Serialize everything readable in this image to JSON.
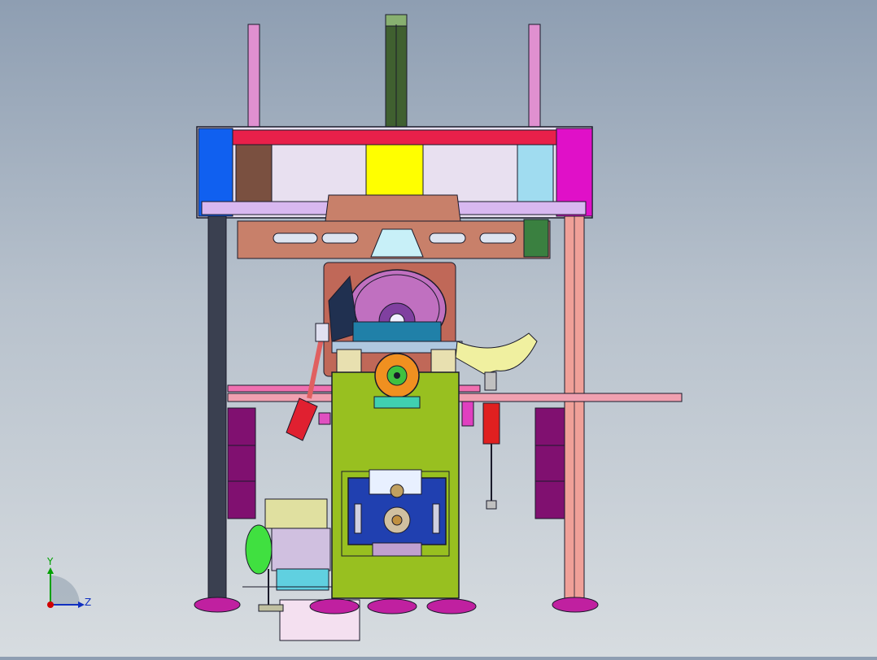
{
  "view": {
    "background_top": "#8e9eb2",
    "background_bottom": "#d7dce0"
  },
  "triad": {
    "y_label": "Y",
    "z_label": "Z",
    "y_color": "#00a000",
    "z_color": "#1030c0",
    "x_color": "#d00000"
  },
  "colors": {
    "outline": "#1a1a2a",
    "top_beam": "#e8204a",
    "blue_block": "#1060f0",
    "brown_block": "#7a5040",
    "yellow_block": "#ffff00",
    "light_blue_block": "#a0dcf0",
    "magenta_block": "#e010c8",
    "lavender_rail": "#d8b8f0",
    "copper_plate": "#c8806a",
    "green_rod": "#406030",
    "pink_rod": "#e090d0",
    "left_post": "#3a4050",
    "right_post": "#f0a098",
    "green_body": "#98c020",
    "purple_wheel": "#c070c0",
    "orange_roller": "#f09020",
    "blue_plate": "#2040b0",
    "purple_panels": "#801070",
    "feet": "#c020a0",
    "motor_green": "#40e040",
    "cream_arm": "#f0f0a0"
  }
}
